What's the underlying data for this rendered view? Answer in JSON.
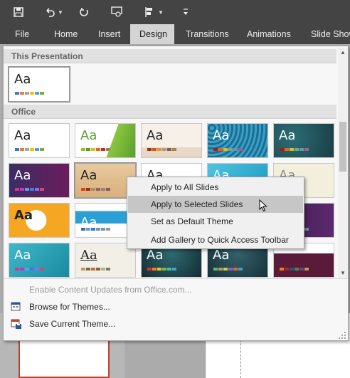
{
  "toolbar": {
    "icons": [
      "save-icon",
      "undo-icon",
      "undo-dropdown-icon",
      "redo-icon",
      "present-from-start-icon",
      "arrange-icon",
      "arrange-dropdown-icon",
      "customize-qat-icon"
    ]
  },
  "tabs": [
    {
      "label": "File",
      "active": false
    },
    {
      "label": "Home",
      "active": false
    },
    {
      "label": "Insert",
      "active": false
    },
    {
      "label": "Design",
      "active": true
    },
    {
      "label": "Transitions",
      "active": false
    },
    {
      "label": "Animations",
      "active": false
    },
    {
      "label": "Slide Show",
      "active": false
    }
  ],
  "gallery": {
    "section_this_presentation": "This Presentation",
    "section_office": "Office",
    "theme_label": "Aa",
    "menu": {
      "enable_updates": "Enable Content Updates from Office.com...",
      "browse_themes": "Browse for Themes...",
      "save_theme": "Save Current Theme..."
    }
  },
  "context_menu": {
    "items": [
      {
        "label": "Apply to All Slides",
        "highlighted": false
      },
      {
        "label": "Apply to Selected Slides",
        "highlighted": true
      },
      {
        "label": "Set as Default Theme",
        "highlighted": false
      },
      {
        "label": "Add Gallery to Quick Access Toolbar",
        "highlighted": false
      }
    ]
  },
  "colors": {
    "title_bar": "#444444",
    "active_tab": "#d4d4d4",
    "gallery_bg": "#f7f7f7",
    "highlight": "#c6c6c6"
  }
}
